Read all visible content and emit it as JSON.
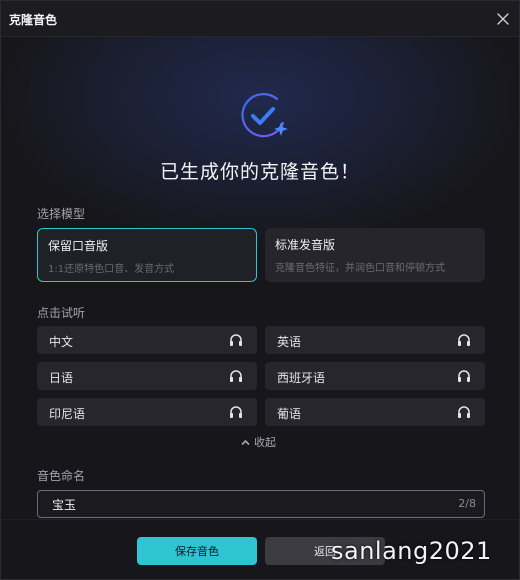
{
  "dialog": {
    "title": "克隆音色",
    "headline": "已生成你的克隆音色！"
  },
  "model_section": {
    "label": "选择模型",
    "options": [
      {
        "name": "保留口音版",
        "desc": "1:1还原特色口音、发音方式",
        "selected": true
      },
      {
        "name": "标准发音版",
        "desc": "克隆音色特征，并润色口音和停顿方式",
        "selected": false
      }
    ]
  },
  "preview_section": {
    "label": "点击试听",
    "languages": [
      "中文",
      "英语",
      "日语",
      "西班牙语",
      "印尼语",
      "葡语"
    ],
    "collapse_label": "收起"
  },
  "name_section": {
    "label": "音色命名",
    "value": "宝玉",
    "counter": "2/8"
  },
  "footer": {
    "save_label": "保存音色",
    "back_label": "返回"
  },
  "watermark": "sanlang2021",
  "colors": {
    "accent": "#2ec4d0",
    "icon_blue": "#3d7cf5",
    "background": "#17171b"
  }
}
